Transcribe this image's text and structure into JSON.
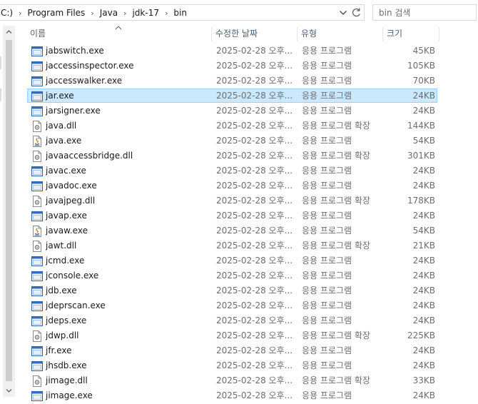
{
  "address": {
    "crumbs": [
      "C:)",
      "Program Files",
      "Java",
      "jdk-17",
      "bin"
    ]
  },
  "search": {
    "placeholder": "bin 검색"
  },
  "columns": {
    "name": "이름",
    "date": "수정한 날짜",
    "type": "유형",
    "size": "크기"
  },
  "colors": {
    "selection_bg": "#cce8ff",
    "selection_border": "#99d1ff",
    "header_text": "#4c607a",
    "meta_text": "#6d6d6d"
  },
  "files": [
    {
      "name": "jabswitch.exe",
      "date": "2025-02-28 오후...",
      "type": "응용 프로그램",
      "size": "45KB",
      "icon": "exe-icon"
    },
    {
      "name": "jaccessinspector.exe",
      "date": "2025-02-28 오후...",
      "type": "응용 프로그램",
      "size": "105KB",
      "icon": "exe-icon"
    },
    {
      "name": "jaccesswalker.exe",
      "date": "2025-02-28 오후...",
      "type": "응용 프로그램",
      "size": "70KB",
      "icon": "exe-icon"
    },
    {
      "name": "jar.exe",
      "date": "2025-02-28 오후...",
      "type": "응용 프로그램",
      "size": "24KB",
      "icon": "exe-icon",
      "selected": true
    },
    {
      "name": "jarsigner.exe",
      "date": "2025-02-28 오후...",
      "type": "응용 프로그램",
      "size": "24KB",
      "icon": "exe-icon"
    },
    {
      "name": "java.dll",
      "date": "2025-02-28 오후...",
      "type": "응용 프로그램 확장",
      "size": "144KB",
      "icon": "dll-icon"
    },
    {
      "name": "java.exe",
      "date": "2025-02-28 오후...",
      "type": "응용 프로그램",
      "size": "54KB",
      "icon": "java-icon"
    },
    {
      "name": "javaaccessbridge.dll",
      "date": "2025-02-28 오후...",
      "type": "응용 프로그램 확장",
      "size": "301KB",
      "icon": "dll-icon"
    },
    {
      "name": "javac.exe",
      "date": "2025-02-28 오후...",
      "type": "응용 프로그램",
      "size": "24KB",
      "icon": "exe-icon"
    },
    {
      "name": "javadoc.exe",
      "date": "2025-02-28 오후...",
      "type": "응용 프로그램",
      "size": "24KB",
      "icon": "exe-icon"
    },
    {
      "name": "javajpeg.dll",
      "date": "2025-02-28 오후...",
      "type": "응용 프로그램 확장",
      "size": "178KB",
      "icon": "dll-icon"
    },
    {
      "name": "javap.exe",
      "date": "2025-02-28 오후...",
      "type": "응용 프로그램",
      "size": "24KB",
      "icon": "exe-icon"
    },
    {
      "name": "javaw.exe",
      "date": "2025-02-28 오후...",
      "type": "응용 프로그램",
      "size": "54KB",
      "icon": "java-icon"
    },
    {
      "name": "jawt.dll",
      "date": "2025-02-28 오후...",
      "type": "응용 프로그램 확장",
      "size": "21KB",
      "icon": "dll-icon"
    },
    {
      "name": "jcmd.exe",
      "date": "2025-02-28 오후...",
      "type": "응용 프로그램",
      "size": "24KB",
      "icon": "exe-icon"
    },
    {
      "name": "jconsole.exe",
      "date": "2025-02-28 오후...",
      "type": "응용 프로그램",
      "size": "24KB",
      "icon": "exe-icon"
    },
    {
      "name": "jdb.exe",
      "date": "2025-02-28 오후...",
      "type": "응용 프로그램",
      "size": "24KB",
      "icon": "exe-icon"
    },
    {
      "name": "jdeprscan.exe",
      "date": "2025-02-28 오후...",
      "type": "응용 프로그램",
      "size": "24KB",
      "icon": "exe-icon"
    },
    {
      "name": "jdeps.exe",
      "date": "2025-02-28 오후...",
      "type": "응용 프로그램",
      "size": "24KB",
      "icon": "exe-icon"
    },
    {
      "name": "jdwp.dll",
      "date": "2025-02-28 오후...",
      "type": "응용 프로그램 확장",
      "size": "225KB",
      "icon": "dll-icon"
    },
    {
      "name": "jfr.exe",
      "date": "2025-02-28 오후...",
      "type": "응용 프로그램",
      "size": "24KB",
      "icon": "exe-icon"
    },
    {
      "name": "jhsdb.exe",
      "date": "2025-02-28 오후...",
      "type": "응용 프로그램",
      "size": "24KB",
      "icon": "exe-icon"
    },
    {
      "name": "jimage.dll",
      "date": "2025-02-28 오후...",
      "type": "응용 프로그램 확장",
      "size": "33KB",
      "icon": "dll-icon"
    },
    {
      "name": "jimage.exe",
      "date": "2025-02-28 오후...",
      "type": "응용 프로그램",
      "size": "24KB",
      "icon": "exe-icon"
    }
  ]
}
